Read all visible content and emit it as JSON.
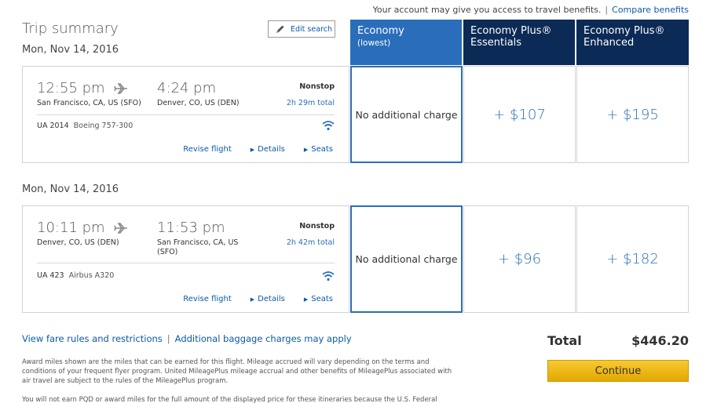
{
  "notice": {
    "text": "Your account may give you access to travel benefits.",
    "separator": "|",
    "link": "Compare benefits"
  },
  "trip": {
    "title": "Trip summary",
    "edit_search": "Edit search"
  },
  "cabins": [
    {
      "name": "Economy",
      "sub": "(lowest)"
    },
    {
      "name": "Economy Plus®",
      "sub": "Essentials"
    },
    {
      "name": "Economy Plus®",
      "sub": "Enhanced"
    }
  ],
  "flights": [
    {
      "date": "Mon, Nov 14, 2016",
      "depart_time": "12:55 pm",
      "depart_city": "San Francisco, CA, US (SFO)",
      "arrive_time": "4:24 pm",
      "arrive_city": "Denver, CO, US (DEN)",
      "stops": "Nonstop",
      "duration": "2h 29m total",
      "flight_number": "UA 2014",
      "aircraft": "Boeing 757-300",
      "revise": "Revise flight",
      "details": "Details",
      "seats": "Seats",
      "prices": [
        "No additional charge",
        "+ $107",
        "+ $195"
      ]
    },
    {
      "date": "Mon, Nov 14, 2016",
      "depart_time": "10:11 pm",
      "depart_city": "Denver, CO, US (DEN)",
      "arrive_time": "11:53 pm",
      "arrive_city": "San Francisco, CA, US (SFO)",
      "stops": "Nonstop",
      "duration": "2h 42m total",
      "flight_number": "UA 423",
      "aircraft": "Airbus A320",
      "revise": "Revise flight",
      "details": "Details",
      "seats": "Seats",
      "prices": [
        "No additional charge",
        "+ $96",
        "+ $182"
      ]
    }
  ],
  "bottom_links": {
    "fare_rules": "View fare rules and restrictions",
    "separator": "|",
    "baggage": "Additional baggage charges may apply"
  },
  "disclaimers": [
    "Award miles shown are the miles that can be earned for this flight. Mileage accrued will vary depending on the terms and conditions of your frequent flyer program. United MileagePlus mileage accrual and other benefits of MileagePlus associated with air travel are subject to the rules of the MileagePlus program.",
    "You will not earn PQD or award miles for the full amount of the displayed price for these itineraries because the U.S. Federal"
  ],
  "total": {
    "label": "Total",
    "amount": "$446.20",
    "continue": "Continue"
  },
  "colors": {
    "economy_header": "#2a6ebb",
    "plus_header": "#0b2a56",
    "link": "#0b5aa7",
    "continue_button": "#f0b90b"
  }
}
